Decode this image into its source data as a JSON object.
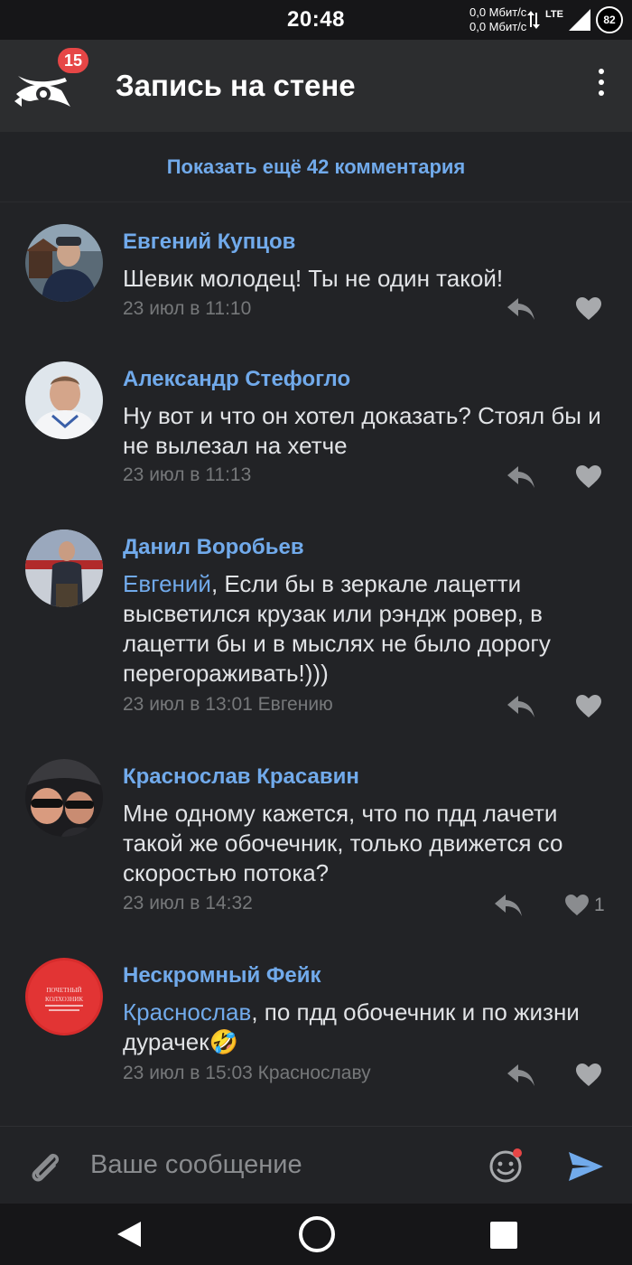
{
  "status_bar": {
    "time": "20:48",
    "net_up": "0,0 Мбит/с",
    "net_down": "0,0 Мбит/с",
    "network": "LTE",
    "battery": "82"
  },
  "app_bar": {
    "notification_count": "15",
    "title": "Запись на стене"
  },
  "show_more": "Показать ещё 42 комментария",
  "comments": [
    {
      "author": "Евгений Купцов",
      "text": "Шевик молодец! Ты не один такой!",
      "date": "23 июл в 11:10"
    },
    {
      "author": "Александр Стефогло",
      "text": "Ну вот и что он хотел доказать? Стоял бы и не вылезал на хетче",
      "date": "23 июл в 11:13"
    },
    {
      "author": "Данил Воробьев",
      "mention": "Евгений",
      "text": ", Если бы в зеркале лацетти высветился крузак или рэндж ровер, в лацетти бы и в мыслях не было дорогу перегораживать!)))",
      "date": "23 июл в 13:01 Евгению"
    },
    {
      "author": "Краснослав Красавин",
      "text": "Мне одному кажется, что по пдд лачети такой же обочечник, только движется со скоростью потока?",
      "date": "23 июл в 14:32",
      "likes": "1"
    },
    {
      "author": "Нескромный Фейк",
      "mention": "Краснослав",
      "text": ", по пдд обочечник и по жизни дурачек",
      "emoji": "🤣",
      "date": "23 июл в 15:03 Краснославу",
      "avatar_text": "ПОЧЕТНЫЙ КОЛХОЗНИК"
    }
  ],
  "composer": {
    "placeholder": "Ваше сообщение"
  },
  "colors": {
    "accent": "#71aaeb",
    "background": "#222326",
    "badge": "#e64646"
  }
}
